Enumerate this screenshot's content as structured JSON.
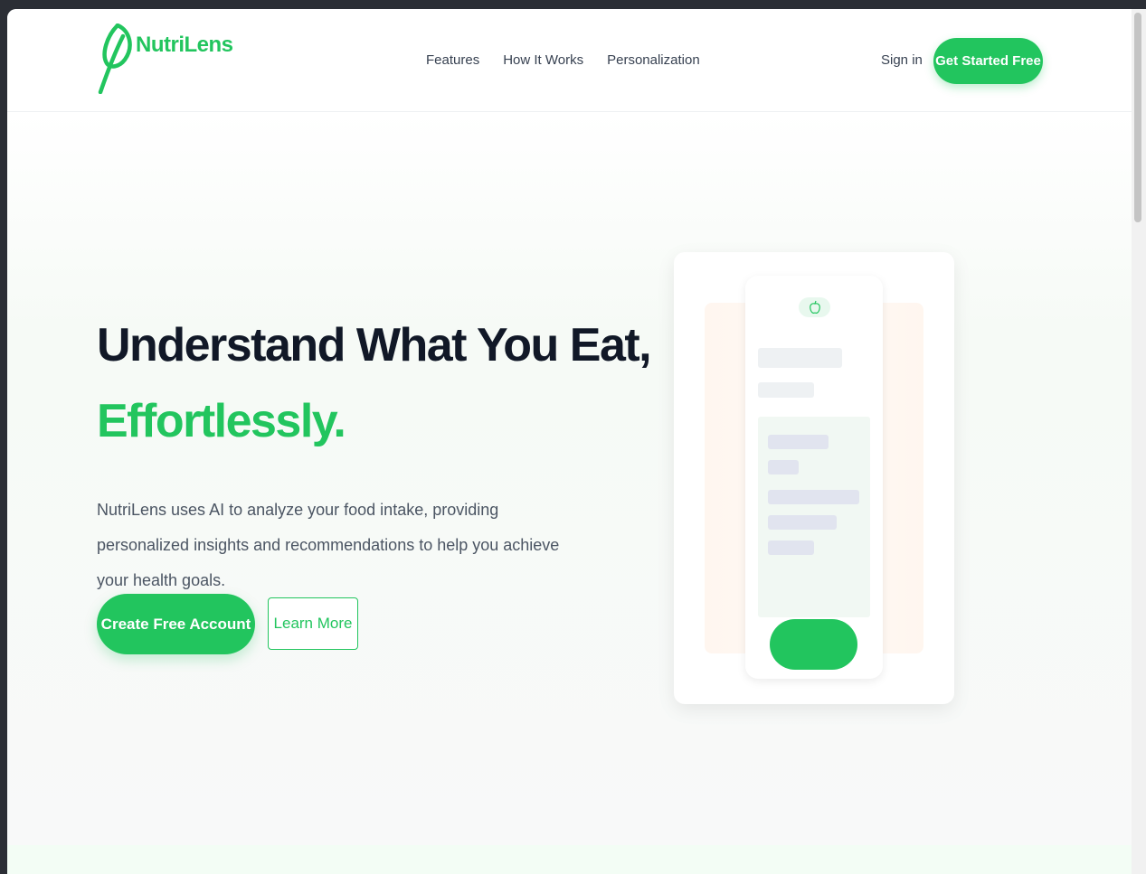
{
  "brand": {
    "name": "NutriLens",
    "color": "#22c55e",
    "icon": "leaf-icon"
  },
  "nav": {
    "links": [
      "Features",
      "How It Works",
      "Personalization"
    ],
    "sign_in": "Sign in",
    "cta": "Get Started Free"
  },
  "hero": {
    "title_line1": "Understand What You Eat,",
    "title_line2": "Effortlessly.",
    "description": "NutriLens uses AI to analyze your food intake, providing personalized insights and recommendations to help you achieve your health goals.",
    "primary_button": "Create Free Account",
    "secondary_button": "Learn More"
  },
  "mockup": {
    "icon": "apple-icon"
  }
}
